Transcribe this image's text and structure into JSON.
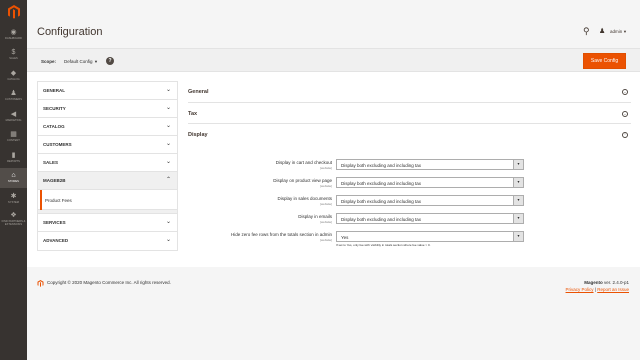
{
  "sidebar": {
    "items": [
      {
        "label": "Dashboard",
        "icon": "dashboard-icon",
        "glyph": "◉"
      },
      {
        "label": "Sales",
        "icon": "dollar-icon",
        "glyph": "$"
      },
      {
        "label": "Catalog",
        "icon": "cube-icon",
        "glyph": "◆"
      },
      {
        "label": "Customers",
        "icon": "customers-icon",
        "glyph": "♟"
      },
      {
        "label": "Marketing",
        "icon": "megaphone-icon",
        "glyph": "◀"
      },
      {
        "label": "Content",
        "icon": "content-icon",
        "glyph": "▦"
      },
      {
        "label": "Reports",
        "icon": "bar-chart-icon",
        "glyph": "▮"
      },
      {
        "label": "Stores",
        "icon": "store-icon",
        "glyph": "⌂"
      },
      {
        "label": "System",
        "icon": "gear-icon",
        "glyph": "✱"
      },
      {
        "label": "Find Partners & Extensions",
        "icon": "partners-icon",
        "glyph": "❖"
      }
    ]
  },
  "header": {
    "title": "Configuration",
    "user": "admin"
  },
  "scope": {
    "label": "Scope:",
    "value": "Default Config",
    "help": "?"
  },
  "save_label": "Save Config",
  "tabs": [
    {
      "label": "GENERAL",
      "chevron": "⌄"
    },
    {
      "label": "SECURITY",
      "chevron": "⌄"
    },
    {
      "label": "CATALOG",
      "chevron": "⌄"
    },
    {
      "label": "CUSTOMERS",
      "chevron": "⌄"
    },
    {
      "label": "SALES",
      "chevron": "⌄"
    },
    {
      "label": "MAGEB2B",
      "chevron": "⌃"
    },
    {
      "label": "SERVICES",
      "chevron": "⌄"
    },
    {
      "label": "ADVANCED",
      "chevron": "⌄"
    }
  ],
  "subtab": {
    "label": "Product Fees"
  },
  "sections": [
    {
      "title": "General",
      "toggle": "⌄"
    },
    {
      "title": "Tax",
      "toggle": "⌄"
    },
    {
      "title": "Display",
      "toggle": "⌃"
    }
  ],
  "fields": [
    {
      "label": "Display in cart and checkout",
      "scope": "[website]",
      "value": "Display both excluding and including tax"
    },
    {
      "label": "Display on product view page",
      "scope": "[website]",
      "value": "Display both excluding and including tax"
    },
    {
      "label": "Display in sales documents",
      "scope": "[website]",
      "value": "Display both excluding and including tax"
    },
    {
      "label": "Display in emails",
      "scope": "[website]",
      "value": "Display both excluding and including tax"
    },
    {
      "label": "Hide zero fee rows from the totals section in admin",
      "scope": "[website]",
      "value": "Yes",
      "note": "If set to Yes, only fee with visibility in totals section where fee value > 0."
    }
  ],
  "footer": {
    "copyright": "Copyright © 2020 Magento Commerce Inc. All rights reserved.",
    "brand": "Magento",
    "version": " ver. 2.4.0-p1",
    "privacy": "Privacy Policy",
    "separator": " | ",
    "report": "Report an Issue"
  },
  "colors": {
    "accent": "#eb5202",
    "sidebar": "#373330"
  }
}
